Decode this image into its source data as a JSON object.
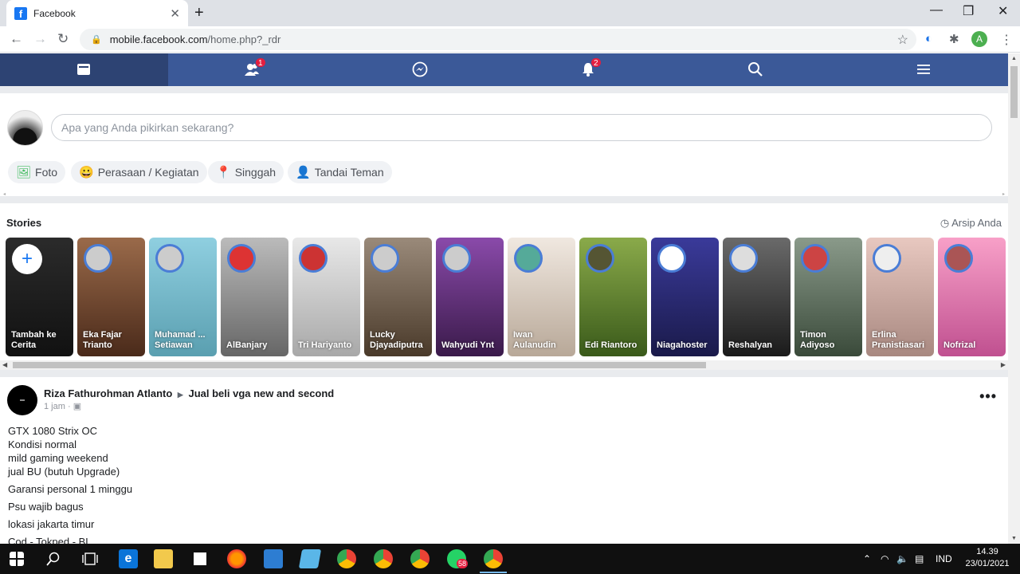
{
  "browser": {
    "tab_title": "Facebook",
    "tab_close": "✕",
    "new_tab": "+",
    "url_host": "mobile.facebook.com",
    "url_path": "/home.php?_rdr",
    "profile_initial": "A",
    "window_min": "—",
    "window_max": "❐",
    "window_close": "✕"
  },
  "fbnav": {
    "friends_badge": "1",
    "notifications_badge": "2"
  },
  "composer": {
    "placeholder": "Apa yang Anda pikirkan sekarang?",
    "chips": [
      {
        "label": "Foto",
        "icon": "photo-icon"
      },
      {
        "label": "Perasaan / Kegiatan",
        "icon": "smiley-icon"
      },
      {
        "label": "Singgah",
        "icon": "location-pin-icon"
      },
      {
        "label": "Tandai Teman",
        "icon": "tag-friend-icon"
      }
    ]
  },
  "stories": {
    "title": "Stories",
    "archive_label": "Arsip Anda",
    "items": [
      {
        "name": "Tambah ke Cerita",
        "color": "#2b2b2b"
      },
      {
        "name": "Eka Fajar Trianto",
        "color": "#8a5a3a"
      },
      {
        "name": "Muhamad ... Setiawan",
        "color": "#7fbfd0"
      },
      {
        "name": "AlBanjary",
        "color": "#9a9a9a"
      },
      {
        "name": "Tri Hariyanto",
        "color": "#c8c8c8"
      },
      {
        "name": "Lucky Djayadiputra",
        "color": "#7a6a5a"
      },
      {
        "name": "Wahyudi Ynt",
        "color": "#6a3a8a"
      },
      {
        "name": "Iwan Aulanudin",
        "color": "#d8c8b8"
      },
      {
        "name": "Edi Riantoro",
        "color": "#5a7a2a"
      },
      {
        "name": "Niagahoster",
        "color": "#2a2a6a"
      },
      {
        "name": "Reshalyan",
        "color": "#3a3a3a"
      },
      {
        "name": "Timon Adiyoso",
        "color": "#6a7a6a"
      },
      {
        "name": "Erlina Pranistiasari",
        "color": "#c8a8a0"
      },
      {
        "name": "Nofrizal",
        "color": "#e080b0"
      }
    ]
  },
  "post": {
    "author": "Riza Fathurohman Atlanto",
    "group": "Jual beli vga new and second",
    "time": "1 jam ·",
    "lines": [
      "GTX 1080 Strix OC",
      "Kondisi normal",
      "mild gaming weekend",
      "jual BU (butuh Upgrade)"
    ],
    "paragraphs": [
      "Garansi personal 1 minggu",
      "Psu wajib bagus",
      "lokasi jakarta timur",
      "Cod - Tokped - BL"
    ]
  },
  "taskbar": {
    "language": "IND",
    "time": "14.39",
    "date": "23/01/2021",
    "chrome_badge": "58"
  }
}
